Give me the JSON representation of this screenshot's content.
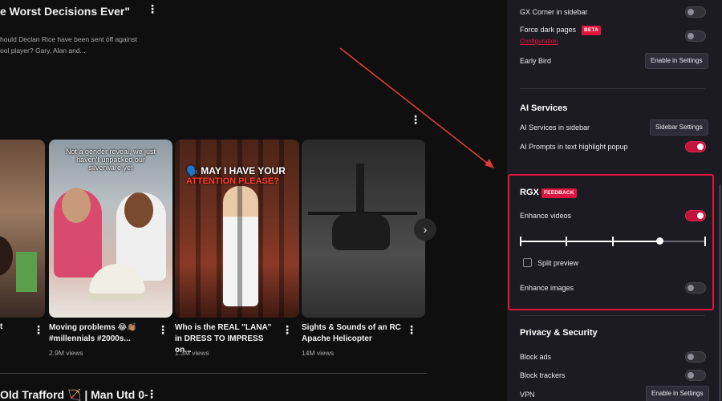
{
  "video_page": {
    "top_title": "e Worst Decisions Ever\"",
    "top_desc": "hould Declan Rice have been sent off against\nool player? Gary, Alan and...",
    "shorts": [
      {
        "title": "t",
        "views": ""
      },
      {
        "title": "Moving problems 😂👏🏽 #millennials #2000s...",
        "views": "2.9M views",
        "caption": "Not a gender reveal, we just haven't unpacked our silverware yet"
      },
      {
        "title": "Who is the REAL \"LANA\" in DRESS TO IMPRESS on...",
        "views": "1.3M views",
        "caption_line1": "🗣️ MAY I HAVE YOUR",
        "caption_line2": "ATTENTION PLEASE?"
      },
      {
        "title": "Sights & Sounds of an RC Apache Helicopter",
        "views": "14M views"
      }
    ],
    "bottom_title": "Old Trafford 🏹 | Man Utd 0-",
    "more_symbol": "⋮",
    "next_symbol": "›"
  },
  "sidebar": {
    "rows": {
      "gx_corner": "GX Corner in sidebar",
      "force_dark": "Force dark pages",
      "force_dark_badge": "BETA",
      "configuration": "Configuration",
      "early_bird": "Early Bird",
      "enable_in_settings": "Enable in Settings",
      "ai_services_head": "AI Services",
      "ai_services_sidebar": "AI Services in sidebar",
      "sidebar_settings": "Sidebar Settings",
      "ai_prompts": "AI Prompts in text highlight popup",
      "rgx_head": "RGX",
      "rgx_badge": "FEEDBACK",
      "enhance_videos": "Enhance videos",
      "split_preview": "Split preview",
      "enhance_images": "Enhance images",
      "privacy_head": "Privacy & Security",
      "block_ads": "Block ads",
      "block_trackers": "Block trackers",
      "vpn": "VPN",
      "vpn_button": "Enable in Settings"
    },
    "toggles": {
      "gx_corner": false,
      "force_dark": false,
      "ai_prompts": true,
      "enhance_videos": true,
      "enhance_images": false,
      "block_ads": false,
      "block_trackers": false
    },
    "enhance_videos_level": 0.75,
    "split_preview_checked": false,
    "accent": "#e0153f"
  }
}
